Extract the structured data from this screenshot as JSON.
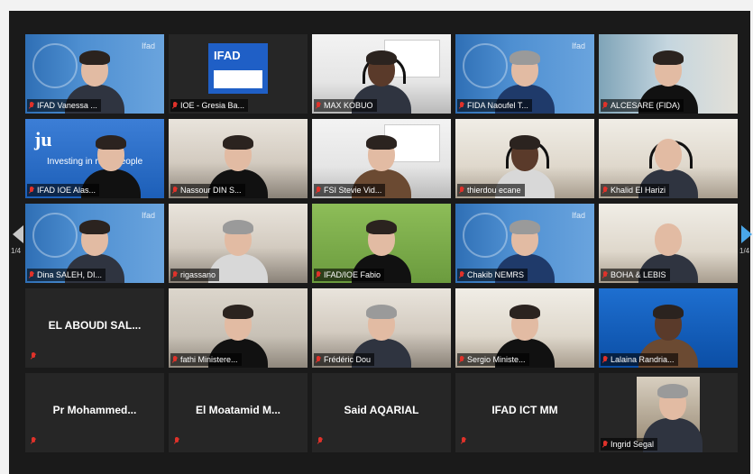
{
  "nav": {
    "prev_page": "1/4",
    "next_page": "1/4"
  },
  "colors": {
    "active_speaker": "#b7e24a",
    "muted_mic": "#e0322a",
    "accent_arrow": "#4aa6e8"
  },
  "tiles": [
    {
      "name": "IFAD Vanessa ...",
      "scene": "un"
    },
    {
      "name": "IOE - Gresia Ba...",
      "scene": "logo",
      "logo_text": "IFAD"
    },
    {
      "name": "MAX KOBUO",
      "scene": "poster"
    },
    {
      "name": "FIDA Naoufel T...",
      "scene": "un"
    },
    {
      "name": "ALCESARE (FIDA)",
      "scene": "window"
    },
    {
      "name": "IFAD IOE Alas...",
      "scene": "ju",
      "logo_text": "ju",
      "tagline": "Investing in rural people"
    },
    {
      "name": "Nassour DIN S...",
      "scene": "room"
    },
    {
      "name": "FSI Stevie Vid...",
      "scene": "poster"
    },
    {
      "name": "thierdou ecane",
      "scene": "wall"
    },
    {
      "name": "Khalid El Harizi",
      "scene": "wall"
    },
    {
      "name": "Dina SALEH, DI...",
      "scene": "un"
    },
    {
      "name": "rigassano",
      "scene": "room"
    },
    {
      "name": "IFAD/IOE Fabio",
      "scene": "green",
      "active": true
    },
    {
      "name": "Chakib NEMRS",
      "scene": "un"
    },
    {
      "name": "BOHA & LEBIS",
      "scene": "wall"
    },
    {
      "name": "EL ABOUDI SAL...",
      "scene": "text"
    },
    {
      "name": "fathi Ministere...",
      "scene": "office"
    },
    {
      "name": "Frédéric Dou",
      "scene": "room"
    },
    {
      "name": "Sergio Ministe...",
      "scene": "wall"
    },
    {
      "name": "Lalaina Randria...",
      "scene": "cyan"
    },
    {
      "name": "Pr  Mohammed...",
      "scene": "text"
    },
    {
      "name": "El Moatamid  M...",
      "scene": "text"
    },
    {
      "name": "Said AQARIAL",
      "scene": "text"
    },
    {
      "name": "IFAD ICT MM",
      "scene": "text"
    },
    {
      "name": "Ingrid Segal",
      "scene": "thumb"
    }
  ]
}
